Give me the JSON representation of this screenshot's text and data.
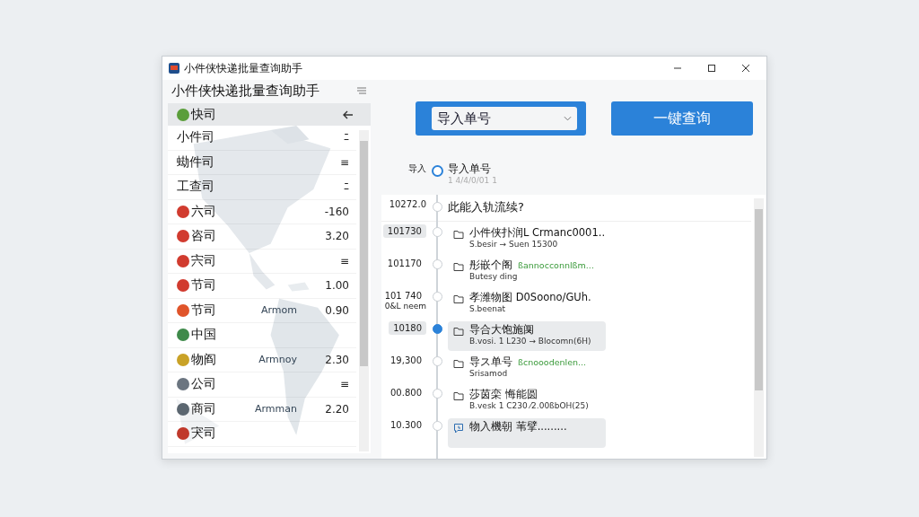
{
  "window": {
    "title": "小件侠快递批量查询助手"
  },
  "sidebar": {
    "title": "小件侠快递批量查询助手",
    "list_header": {
      "label": "快司",
      "color": "#5a9e3a"
    },
    "items": [
      {
        "name": "小件司",
        "value": "ﾆ"
      },
      {
        "name": "蜐件司",
        "value": "≡"
      },
      {
        "name": "工查司",
        "value": "ﾆ"
      },
      {
        "name": "六司",
        "value": "-160",
        "color": "#d13b2f"
      },
      {
        "name": "咨司",
        "value": "3.20",
        "color": "#d13b2f"
      },
      {
        "name": "宍司",
        "value": "≡",
        "color": "#d13b2f"
      },
      {
        "name": "节司",
        "value": "1.00",
        "color": "#d13b2f"
      },
      {
        "name": "节司",
        "note": "Armom",
        "value": "0.90",
        "color": "#e0542a"
      },
      {
        "name": "中国",
        "color": "#3f8a4a"
      },
      {
        "name": "物阎",
        "note": "Armnoy",
        "value": "2.30",
        "color": "#c9a227"
      },
      {
        "name": "公司",
        "value": "≡",
        "color": "#6b7580"
      },
      {
        "name": "商司",
        "note": "Armman",
        "value": "2.20",
        "color": "#5b6670"
      },
      {
        "name": "宊司",
        "color": "#c0392b"
      }
    ]
  },
  "toolbar": {
    "import_select": {
      "value": "导入单号"
    },
    "query_button": "一键查询"
  },
  "timeline": {
    "header": {
      "label": "导入",
      "title": "导入单号",
      "subtitle": "1 4/4/0/01 1"
    },
    "first": {
      "time": "10272.0",
      "title": "此能入轨流续?"
    },
    "entries": [
      {
        "time": "101730",
        "kind": "folder",
        "title": "小件侠扑润L Crmanc0001..",
        "subtitle": "S.besir → Suen 15300",
        "selected": false,
        "highlighted": false,
        "time_highlighted": true
      },
      {
        "time": "101170",
        "kind": "folder",
        "title": "彤嵌个阁",
        "note": "ßannocconnlßm...",
        "subtitle": "Butesy ding",
        "selected": false,
        "highlighted": false,
        "time_highlighted": false
      },
      {
        "time": "101 740",
        "time_extra": "0&L neem",
        "kind": "folder",
        "title": "孝潍物图 D0Soono/GUh.",
        "subtitle": "S.beenat",
        "selected": false,
        "highlighted": false,
        "time_highlighted": false
      },
      {
        "time": "10180",
        "kind": "folder",
        "title": "导合大饱施阒",
        "subtitle": "B.vosi. 1 L230 → Blocomn(6H)",
        "selected": true,
        "highlighted": true,
        "time_highlighted": true
      },
      {
        "time": "19,300",
        "kind": "folder",
        "title": "导ス单号",
        "note": "ßcnooodenlen...",
        "subtitle": "Srisamod",
        "selected": false,
        "highlighted": false,
        "time_highlighted": false
      },
      {
        "time": "00.800",
        "kind": "folder",
        "title": "莎茵栾 悔能圆",
        "subtitle": "B.vesk 1 C230 ⁄2.00ßbOH(25)",
        "selected": false,
        "highlighted": false,
        "time_highlighted": false
      },
      {
        "time": "10.300",
        "kind": "chat",
        "title": "物入機朝 苇擘.........",
        "selected": false,
        "highlighted": true,
        "time_highlighted": false
      }
    ]
  }
}
